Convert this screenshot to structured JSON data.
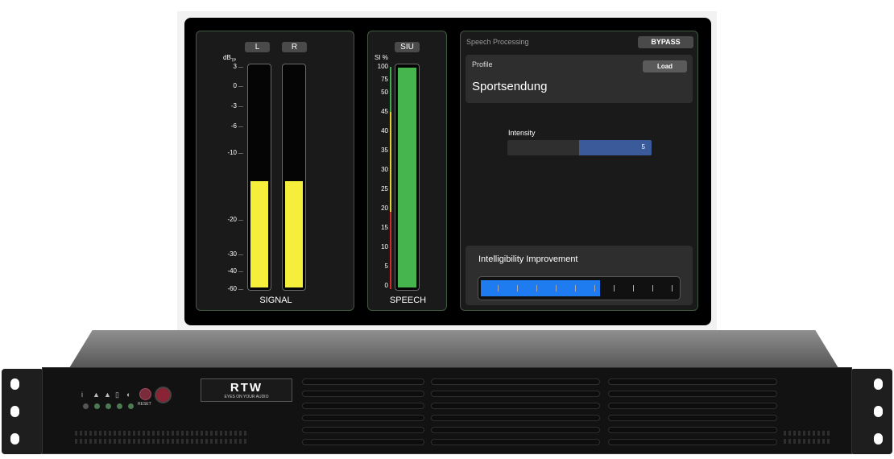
{
  "screen": {
    "signal_panel": {
      "title": "SIGNAL",
      "channel_left": "L",
      "channel_right": "R",
      "unit": "dB",
      "unit_sub": "TP",
      "scale": [
        "3",
        "0",
        "-3",
        "-6",
        "-10",
        "-20",
        "-30",
        "-40",
        "-60"
      ],
      "level_left": 0.48,
      "level_right": 0.48
    },
    "speech_panel": {
      "title": "SPEECH",
      "button": "SIU",
      "unit": "SI %",
      "scale": [
        "100",
        "75",
        "50",
        "45",
        "40",
        "35",
        "30",
        "25",
        "20",
        "15",
        "10",
        "5",
        "0"
      ],
      "level": 0.99
    },
    "processing_panel": {
      "title": "Speech Processing",
      "bypass_label": "BYPASS",
      "profile_label": "Profile",
      "load_label": "Load",
      "profile_name": "Sportsendung",
      "intensity_label": "Intensity",
      "intensity_value": "5",
      "improvement_label": "Intelligibility Improvement",
      "improvement_level": 0.6
    }
  },
  "device": {
    "brand": "RTW",
    "tagline": "EYES ON YOUR AUDIO",
    "reset_label": "RESET",
    "indicator_icons": [
      "info-icon",
      "network-icon",
      "network-icon",
      "sd-card-icon",
      "bulb-icon"
    ]
  }
}
